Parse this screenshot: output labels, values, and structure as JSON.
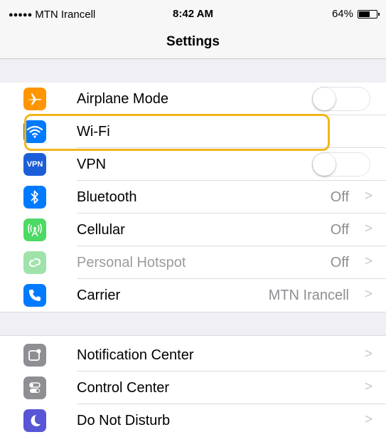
{
  "status_bar": {
    "signal": "●●●●●",
    "carrier": "MTN Irancell",
    "time": "8:42 AM",
    "battery_text": "64%",
    "battery_level": 0.64
  },
  "nav": {
    "title": "Settings"
  },
  "group1": {
    "rows": [
      {
        "label": "Airplane Mode",
        "icon": "airplane-icon",
        "color": "#ff9500",
        "control": "toggle",
        "toggle_on": false
      },
      {
        "label": "Wi-Fi",
        "icon": "wifi-icon",
        "color": "#007aff",
        "control": "chevron",
        "value": "",
        "highlighted": true
      },
      {
        "label": "VPN",
        "icon_text": "VPN",
        "icon": "vpn-icon",
        "color": "#1b5ed8",
        "control": "toggle",
        "toggle_on": false
      },
      {
        "label": "Bluetooth",
        "icon": "bluetooth-icon",
        "color": "#007aff",
        "control": "chevron",
        "value": "Off"
      },
      {
        "label": "Cellular",
        "icon": "cellular-icon",
        "color": "#4cd964",
        "control": "chevron",
        "value": "Off"
      },
      {
        "label": "Personal Hotspot",
        "icon": "hotspot-icon",
        "color": "#9fe3ab",
        "control": "chevron",
        "value": "Off",
        "dimmed": true
      },
      {
        "label": "Carrier",
        "icon": "phone-icon",
        "color": "#007aff",
        "control": "chevron",
        "value": "MTN Irancell"
      }
    ]
  },
  "group2": {
    "rows": [
      {
        "label": "Notification Center",
        "icon": "notification-center-icon",
        "color": "#8e8e93",
        "control": "chevron"
      },
      {
        "label": "Control Center",
        "icon": "control-center-icon",
        "color": "#8e8e93",
        "control": "chevron"
      },
      {
        "label": "Do Not Disturb",
        "icon": "moon-icon",
        "color": "#5856d6",
        "control": "chevron"
      }
    ]
  },
  "chevron": ">",
  "highlight_color": "#f2b51e"
}
